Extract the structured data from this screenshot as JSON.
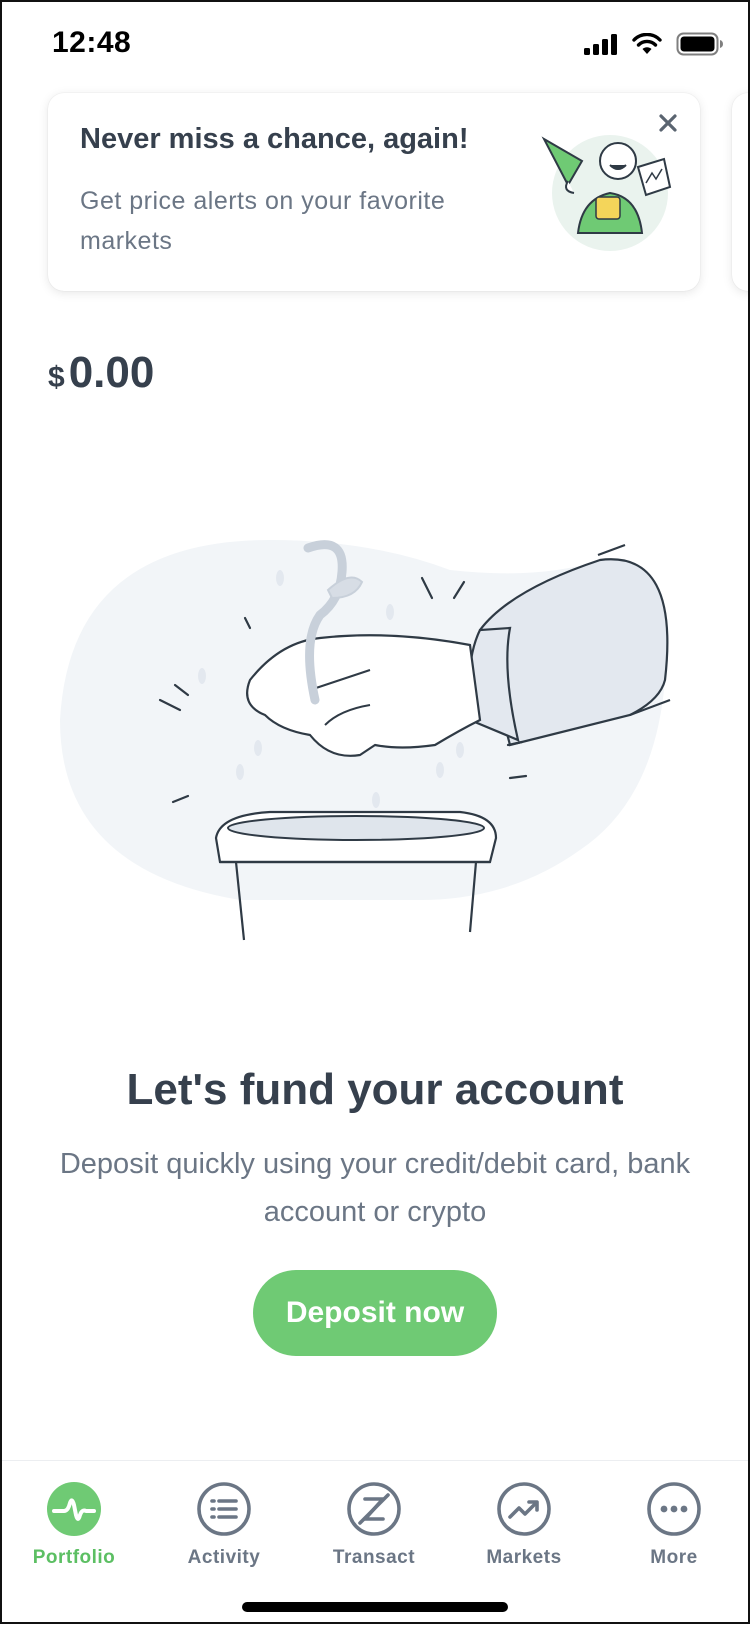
{
  "status_bar": {
    "time": "12:48"
  },
  "promo": {
    "title": "Never miss a chance, again!",
    "text": "Get price alerts on your favorite markets"
  },
  "balance": {
    "currency": "$",
    "amount": "0.00"
  },
  "empty_state": {
    "title": "Let's fund your account",
    "description": "Deposit quickly using your credit/debit card, bank account or crypto",
    "button_label": "Deposit now"
  },
  "tabs": [
    {
      "label": "Portfolio",
      "icon": "pulse-icon",
      "active": true
    },
    {
      "label": "Activity",
      "icon": "list-icon",
      "active": false
    },
    {
      "label": "Transact",
      "icon": "transact-icon",
      "active": false
    },
    {
      "label": "Markets",
      "icon": "trending-up-icon",
      "active": false
    },
    {
      "label": "More",
      "icon": "more-icon",
      "active": false
    }
  ],
  "colors": {
    "accent": "#6fca74",
    "accent_text": "#5cbf63",
    "text_dark": "#36404d",
    "text_muted": "#6b7685",
    "illustration_bg": "#f2f5f8"
  }
}
